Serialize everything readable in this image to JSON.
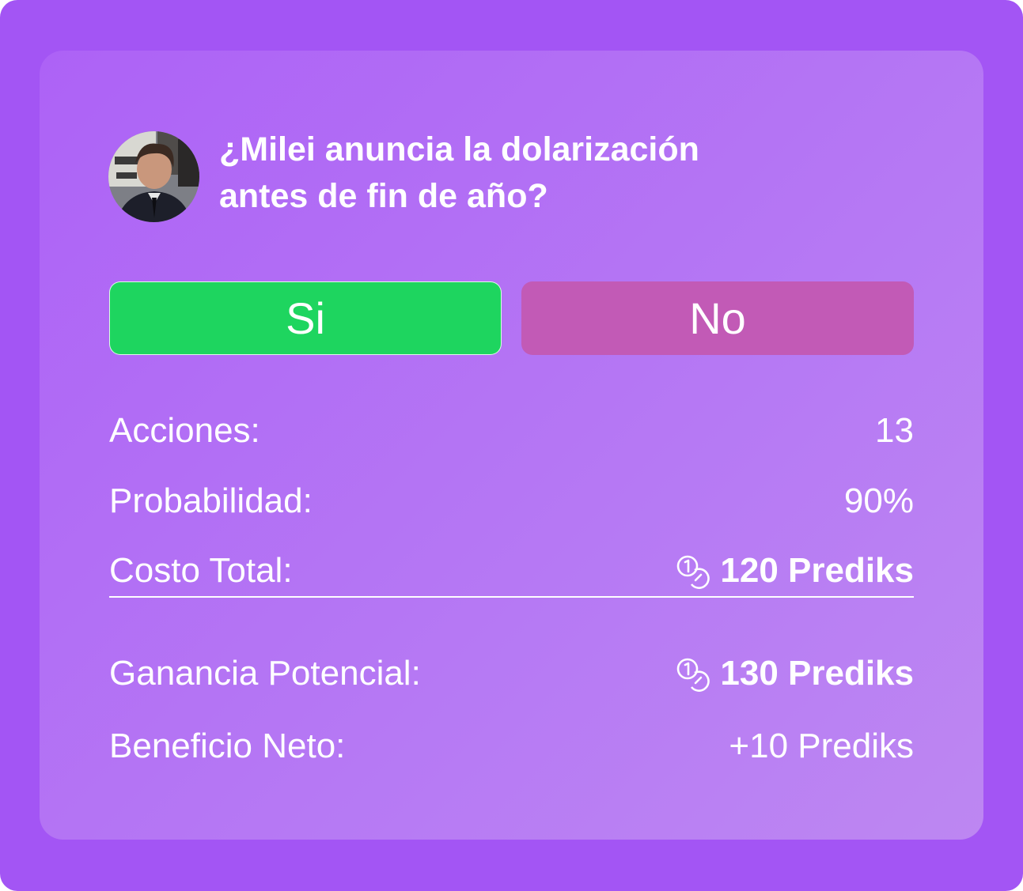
{
  "question": {
    "line1": "¿Milei anuncia la dolarización",
    "line2": "antes de fin de año?"
  },
  "avatar": {
    "icon": "person-photo-avatar"
  },
  "buttons": {
    "yes_label": "Si",
    "no_label": "No",
    "yes_color": "#1ed55f",
    "no_color": "#c25ab6"
  },
  "stats": {
    "acciones": {
      "label": "Acciones:",
      "value": "13"
    },
    "probabilidad": {
      "label": "Probabilidad:",
      "value": "90%"
    },
    "costo_total": {
      "label": "Costo Total:",
      "value": "120 Prediks",
      "icon": "coins-icon"
    },
    "ganancia_potencial": {
      "label": "Ganancia Potencial:",
      "value": "130 Prediks",
      "icon": "coins-icon"
    },
    "beneficio_neto": {
      "label": "Beneficio Neto:",
      "value": "+10 Prediks"
    }
  },
  "colors": {
    "background": "#a355f4",
    "card": "#b679f4",
    "text": "#ffffff"
  }
}
